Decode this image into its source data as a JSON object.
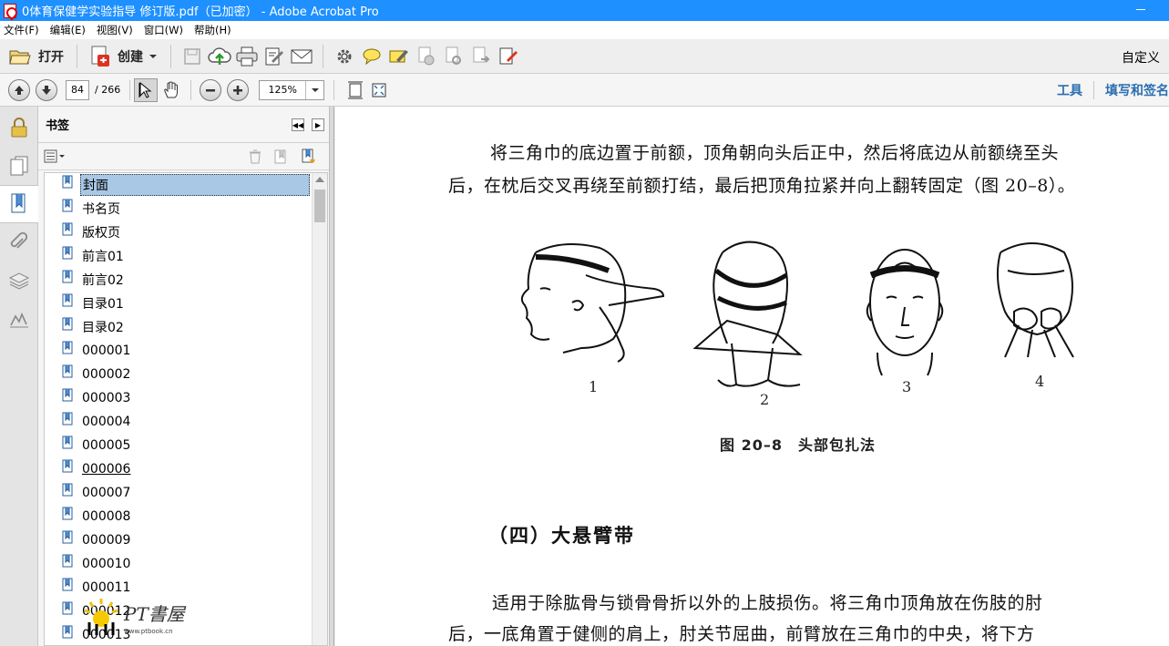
{
  "window": {
    "title": "0体育保健学实验指导 修订版.pdf（已加密） - Adobe Acrobat Pro"
  },
  "menu": [
    "文件(F)",
    "编辑(E)",
    "视图(V)",
    "窗口(W)",
    "帮助(H)"
  ],
  "toolbar": {
    "open_label": "打开",
    "create_label": "创建",
    "customize_label": "自定义"
  },
  "nav": {
    "page_current": "84",
    "page_total": "/ 266",
    "zoom": "125%",
    "tools_label": "工具",
    "fill_sign_label": "填写和签名"
  },
  "bookmarks": {
    "title": "书签",
    "items": [
      {
        "label": "封面",
        "selected": true
      },
      {
        "label": "书名页"
      },
      {
        "label": "版权页"
      },
      {
        "label": "前言01"
      },
      {
        "label": "前言02"
      },
      {
        "label": "目录01"
      },
      {
        "label": "目录02"
      },
      {
        "label": "000001"
      },
      {
        "label": "000002"
      },
      {
        "label": "000003"
      },
      {
        "label": "000004"
      },
      {
        "label": "000005"
      },
      {
        "label": "000006",
        "underline": true
      },
      {
        "label": "000007"
      },
      {
        "label": "000008"
      },
      {
        "label": "000009"
      },
      {
        "label": "000010"
      },
      {
        "label": "000011"
      },
      {
        "label": "000012"
      },
      {
        "label": "000013"
      }
    ]
  },
  "watermark": {
    "text": "PT書屋",
    "url": "www.ptbook.cn"
  },
  "document": {
    "para1_line1": "将三角巾的底边置于前额，顶角朝向头后正中，然后将底边从前额绕至头",
    "para1_line2": "后，在枕后交叉再绕至前额打结，最后把顶角拉紧并向上翻转固定（图 20–8）。",
    "figure_labels": [
      "1",
      "2",
      "3",
      "4"
    ],
    "figure_caption": "图 20–8　头部包扎法",
    "section_heading": "（四）大悬臂带",
    "para2_line1": "适用于除肱骨与锁骨骨折以外的上肢损伤。将三角巾顶角放在伤肢的肘",
    "para2_line2": "后，一底角置于健侧的肩上，肘关节屈曲，前臂放在三角巾的中央，将下方"
  }
}
